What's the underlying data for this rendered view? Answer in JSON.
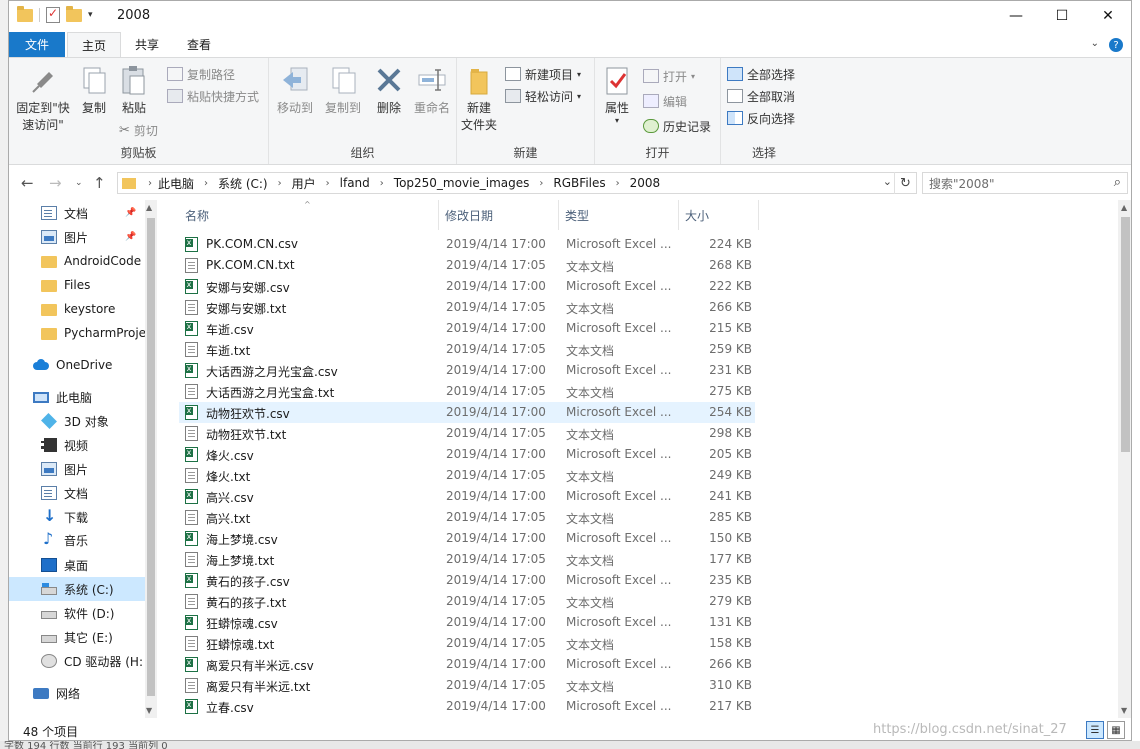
{
  "window": {
    "title": "2008",
    "minimize": "—",
    "maximize": "☐",
    "close": "✕"
  },
  "tabs": {
    "file": "文件",
    "home": "主页",
    "share": "共享",
    "view": "查看"
  },
  "ribbon": {
    "clipboard": {
      "label": "剪贴板",
      "pin_quick": "固定到\"快\n速访问\"",
      "copy": "复制",
      "paste": "粘贴",
      "copy_path": "复制路径",
      "paste_shortcut": "粘贴快捷方式",
      "cut": "剪切"
    },
    "organize": {
      "label": "组织",
      "move_to": "移动到",
      "copy_to": "复制到",
      "delete": "删除",
      "rename": "重命名"
    },
    "new": {
      "label": "新建",
      "new_folder": "新建\n文件夹",
      "new_item": "新建项目",
      "easy_access": "轻松访问"
    },
    "open": {
      "label": "打开",
      "properties": "属性",
      "open": "打开",
      "edit": "编辑",
      "history": "历史记录"
    },
    "select": {
      "label": "选择",
      "select_all": "全部选择",
      "select_none": "全部取消",
      "invert": "反向选择"
    }
  },
  "address": {
    "crumbs": [
      "此电脑",
      "系统 (C:)",
      "用户",
      "lfand",
      "Top250_movie_images",
      "RGBFiles",
      "2008"
    ],
    "search_placeholder": "搜索\"2008\""
  },
  "nav": [
    {
      "label": "文档",
      "icon": "documents-icon",
      "pinned": true
    },
    {
      "label": "图片",
      "icon": "pictures-icon",
      "pinned": true
    },
    {
      "label": "AndroidCode",
      "icon": "folder-icon"
    },
    {
      "label": "Files",
      "icon": "folder-icon"
    },
    {
      "label": "keystore",
      "icon": "folder-icon"
    },
    {
      "label": "PycharmProje",
      "icon": "folder-icon"
    },
    {
      "label": "OneDrive",
      "icon": "onedrive-icon"
    },
    {
      "label": "此电脑",
      "icon": "this-pc-icon"
    },
    {
      "label": "3D 对象",
      "icon": "3d-objects-icon"
    },
    {
      "label": "视频",
      "icon": "videos-icon"
    },
    {
      "label": "图片",
      "icon": "pictures-icon"
    },
    {
      "label": "文档",
      "icon": "documents-icon"
    },
    {
      "label": "下载",
      "icon": "downloads-icon"
    },
    {
      "label": "音乐",
      "icon": "music-icon"
    },
    {
      "label": "桌面",
      "icon": "desktop-icon"
    },
    {
      "label": "系统 (C:)",
      "icon": "system-drive-icon",
      "selected": true
    },
    {
      "label": "软件 (D:)",
      "icon": "drive-icon"
    },
    {
      "label": "其它 (E:)",
      "icon": "drive-icon"
    },
    {
      "label": "CD 驱动器 (H:",
      "icon": "cd-drive-icon"
    },
    {
      "label": "网络",
      "icon": "network-icon"
    }
  ],
  "columns": {
    "name": "名称",
    "date": "修改日期",
    "type": "类型",
    "size": "大小"
  },
  "files": [
    {
      "name": "PK.COM.CN.csv",
      "date": "2019/4/14 17:00",
      "type": "Microsoft Excel ...",
      "size": "224 KB",
      "kind": "csv"
    },
    {
      "name": "PK.COM.CN.txt",
      "date": "2019/4/14 17:05",
      "type": "文本文档",
      "size": "268 KB",
      "kind": "txt"
    },
    {
      "name": "安娜与安娜.csv",
      "date": "2019/4/14 17:00",
      "type": "Microsoft Excel ...",
      "size": "222 KB",
      "kind": "csv"
    },
    {
      "name": "安娜与安娜.txt",
      "date": "2019/4/14 17:05",
      "type": "文本文档",
      "size": "266 KB",
      "kind": "txt"
    },
    {
      "name": "车逝.csv",
      "date": "2019/4/14 17:00",
      "type": "Microsoft Excel ...",
      "size": "215 KB",
      "kind": "csv"
    },
    {
      "name": "车逝.txt",
      "date": "2019/4/14 17:05",
      "type": "文本文档",
      "size": "259 KB",
      "kind": "txt"
    },
    {
      "name": "大话西游之月光宝盒.csv",
      "date": "2019/4/14 17:00",
      "type": "Microsoft Excel ...",
      "size": "231 KB",
      "kind": "csv"
    },
    {
      "name": "大话西游之月光宝盒.txt",
      "date": "2019/4/14 17:05",
      "type": "文本文档",
      "size": "275 KB",
      "kind": "txt"
    },
    {
      "name": "动物狂欢节.csv",
      "date": "2019/4/14 17:00",
      "type": "Microsoft Excel ...",
      "size": "254 KB",
      "kind": "csv",
      "highlight": true
    },
    {
      "name": "动物狂欢节.txt",
      "date": "2019/4/14 17:05",
      "type": "文本文档",
      "size": "298 KB",
      "kind": "txt"
    },
    {
      "name": "烽火.csv",
      "date": "2019/4/14 17:00",
      "type": "Microsoft Excel ...",
      "size": "205 KB",
      "kind": "csv"
    },
    {
      "name": "烽火.txt",
      "date": "2019/4/14 17:05",
      "type": "文本文档",
      "size": "249 KB",
      "kind": "txt"
    },
    {
      "name": "高兴.csv",
      "date": "2019/4/14 17:00",
      "type": "Microsoft Excel ...",
      "size": "241 KB",
      "kind": "csv"
    },
    {
      "name": "高兴.txt",
      "date": "2019/4/14 17:05",
      "type": "文本文档",
      "size": "285 KB",
      "kind": "txt"
    },
    {
      "name": "海上梦境.csv",
      "date": "2019/4/14 17:00",
      "type": "Microsoft Excel ...",
      "size": "150 KB",
      "kind": "csv"
    },
    {
      "name": "海上梦境.txt",
      "date": "2019/4/14 17:05",
      "type": "文本文档",
      "size": "177 KB",
      "kind": "txt"
    },
    {
      "name": "黄石的孩子.csv",
      "date": "2019/4/14 17:00",
      "type": "Microsoft Excel ...",
      "size": "235 KB",
      "kind": "csv"
    },
    {
      "name": "黄石的孩子.txt",
      "date": "2019/4/14 17:05",
      "type": "文本文档",
      "size": "279 KB",
      "kind": "txt"
    },
    {
      "name": "狂蟒惊魂.csv",
      "date": "2019/4/14 17:00",
      "type": "Microsoft Excel ...",
      "size": "131 KB",
      "kind": "csv"
    },
    {
      "name": "狂蟒惊魂.txt",
      "date": "2019/4/14 17:05",
      "type": "文本文档",
      "size": "158 KB",
      "kind": "txt"
    },
    {
      "name": "离爱只有半米远.csv",
      "date": "2019/4/14 17:00",
      "type": "Microsoft Excel ...",
      "size": "266 KB",
      "kind": "csv"
    },
    {
      "name": "离爱只有半米远.txt",
      "date": "2019/4/14 17:05",
      "type": "文本文档",
      "size": "310 KB",
      "kind": "txt"
    },
    {
      "name": "立春.csv",
      "date": "2019/4/14 17:00",
      "type": "Microsoft Excel ...",
      "size": "217 KB",
      "kind": "csv"
    }
  ],
  "status": {
    "count": "48 个项目",
    "watermark": "https://blog.csdn.net/sinat_27"
  },
  "background": {
    "editor_status": "字数 194 行数 当前行 193 当前列 0"
  },
  "colors": {
    "accent": "#1979ca",
    "selection": "#cce8ff",
    "hover_row": "#e5f3ff",
    "folder": "#f2c55c"
  }
}
